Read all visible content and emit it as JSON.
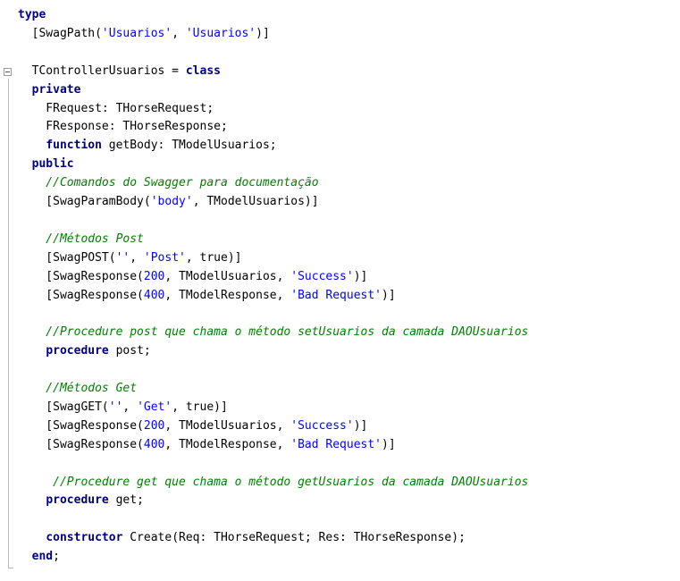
{
  "editor": {
    "language": "Delphi/Pascal",
    "colors": {
      "keyword": "#000080",
      "comment": "#008000",
      "string": "#0000ff",
      "text": "#000000",
      "background": "#ffffff"
    },
    "lines": [
      [
        {
          "t": "kw",
          "v": "type"
        }
      ],
      [
        {
          "t": "p",
          "v": "  [SwagPath("
        },
        {
          "t": "str",
          "v": "'Usuarios'"
        },
        {
          "t": "p",
          "v": ", "
        },
        {
          "t": "str",
          "v": "'Usuarios'"
        },
        {
          "t": "p",
          "v": ")]"
        }
      ],
      [],
      [
        {
          "t": "p",
          "v": "  TControllerUsuarios = "
        },
        {
          "t": "kw",
          "v": "class"
        }
      ],
      [
        {
          "t": "kw",
          "v": "  private"
        }
      ],
      [
        {
          "t": "p",
          "v": "    FRequest: THorseRequest;"
        }
      ],
      [
        {
          "t": "p",
          "v": "    FResponse: THorseResponse;"
        }
      ],
      [
        {
          "t": "p",
          "v": "    "
        },
        {
          "t": "kw",
          "v": "function"
        },
        {
          "t": "p",
          "v": " getBody: TModelUsuarios;"
        }
      ],
      [
        {
          "t": "kw",
          "v": "  public"
        }
      ],
      [
        {
          "t": "cm",
          "v": "    //Comandos do Swagger para documentação"
        }
      ],
      [
        {
          "t": "p",
          "v": "    [SwagParamBody("
        },
        {
          "t": "str",
          "v": "'body'"
        },
        {
          "t": "p",
          "v": ", TModelUsuarios)]"
        }
      ],
      [],
      [
        {
          "t": "cm",
          "v": "    //Métodos Post"
        }
      ],
      [
        {
          "t": "p",
          "v": "    [SwagPOST("
        },
        {
          "t": "str",
          "v": "''"
        },
        {
          "t": "p",
          "v": ", "
        },
        {
          "t": "str",
          "v": "'Post'"
        },
        {
          "t": "p",
          "v": ", true)]"
        }
      ],
      [
        {
          "t": "p",
          "v": "    [SwagResponse("
        },
        {
          "t": "num",
          "v": "200"
        },
        {
          "t": "p",
          "v": ", TModelUsuarios, "
        },
        {
          "t": "str",
          "v": "'Success'"
        },
        {
          "t": "p",
          "v": ")]"
        }
      ],
      [
        {
          "t": "p",
          "v": "    [SwagResponse("
        },
        {
          "t": "num",
          "v": "400"
        },
        {
          "t": "p",
          "v": ", TModelResponse, "
        },
        {
          "t": "str",
          "v": "'Bad Request'"
        },
        {
          "t": "p",
          "v": ")]"
        }
      ],
      [],
      [
        {
          "t": "cm",
          "v": "    //Procedure post que chama o método setUsuarios da camada DAOUsuarios"
        }
      ],
      [
        {
          "t": "p",
          "v": "    "
        },
        {
          "t": "kw",
          "v": "procedure"
        },
        {
          "t": "p",
          "v": " post;"
        }
      ],
      [],
      [
        {
          "t": "cm",
          "v": "    //Métodos Get"
        }
      ],
      [
        {
          "t": "p",
          "v": "    [SwagGET("
        },
        {
          "t": "str",
          "v": "''"
        },
        {
          "t": "p",
          "v": ", "
        },
        {
          "t": "str",
          "v": "'Get'"
        },
        {
          "t": "p",
          "v": ", true)]"
        }
      ],
      [
        {
          "t": "p",
          "v": "    [SwagResponse("
        },
        {
          "t": "num",
          "v": "200"
        },
        {
          "t": "p",
          "v": ", TModelUsuarios, "
        },
        {
          "t": "str",
          "v": "'Success'"
        },
        {
          "t": "p",
          "v": ")]"
        }
      ],
      [
        {
          "t": "p",
          "v": "    [SwagResponse("
        },
        {
          "t": "num",
          "v": "400"
        },
        {
          "t": "p",
          "v": ", TModelResponse, "
        },
        {
          "t": "str",
          "v": "'Bad Request'"
        },
        {
          "t": "p",
          "v": ")]"
        }
      ],
      [],
      [
        {
          "t": "cm",
          "v": "     //Procedure get que chama o método getUsuarios da camada DAOUsuarios"
        }
      ],
      [
        {
          "t": "p",
          "v": "    "
        },
        {
          "t": "kw",
          "v": "procedure"
        },
        {
          "t": "p",
          "v": " get;"
        }
      ],
      [],
      [
        {
          "t": "p",
          "v": "    "
        },
        {
          "t": "kw",
          "v": "constructor"
        },
        {
          "t": "p",
          "v": " Create(Req: THorseRequest; Res: THorseResponse);"
        }
      ],
      [
        {
          "t": "p",
          "v": "  "
        },
        {
          "t": "kw",
          "v": "end"
        },
        {
          "t": "p",
          "v": ";"
        }
      ]
    ]
  }
}
